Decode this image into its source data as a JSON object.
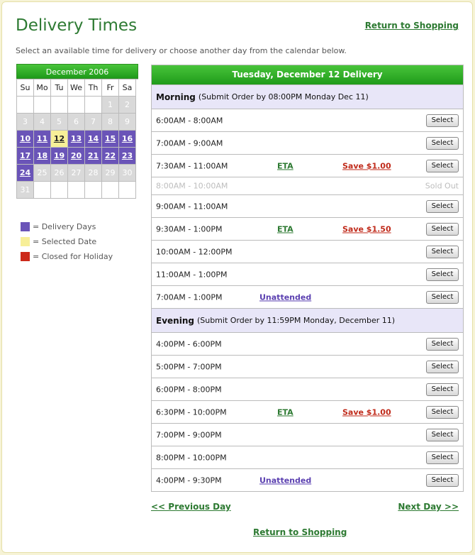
{
  "page": {
    "title": "Delivery Times",
    "return_top": "Return to Shopping",
    "instructions": "Select an available time for delivery or choose another day from the calendar below.",
    "prev_day": "<< Previous Day",
    "next_day": "Next Day >>",
    "return_bottom": "Return to Shopping"
  },
  "calendar": {
    "month": "December 2006",
    "days_of_week": [
      "Su",
      "Mo",
      "Tu",
      "We",
      "Th",
      "Fr",
      "Sa"
    ],
    "cells": [
      {
        "label": "",
        "state": "blank"
      },
      {
        "label": "",
        "state": "blank"
      },
      {
        "label": "",
        "state": "blank"
      },
      {
        "label": "",
        "state": "blank"
      },
      {
        "label": "",
        "state": "blank"
      },
      {
        "label": "1",
        "state": "past"
      },
      {
        "label": "2",
        "state": "past"
      },
      {
        "label": "3",
        "state": "past"
      },
      {
        "label": "4",
        "state": "past"
      },
      {
        "label": "5",
        "state": "past"
      },
      {
        "label": "6",
        "state": "past"
      },
      {
        "label": "7",
        "state": "past"
      },
      {
        "label": "8",
        "state": "past"
      },
      {
        "label": "9",
        "state": "past"
      },
      {
        "label": "10",
        "state": "delivery"
      },
      {
        "label": "11",
        "state": "delivery"
      },
      {
        "label": "12",
        "state": "selected"
      },
      {
        "label": "13",
        "state": "delivery"
      },
      {
        "label": "14",
        "state": "delivery"
      },
      {
        "label": "15",
        "state": "delivery"
      },
      {
        "label": "16",
        "state": "delivery"
      },
      {
        "label": "17",
        "state": "delivery"
      },
      {
        "label": "18",
        "state": "delivery"
      },
      {
        "label": "19",
        "state": "delivery"
      },
      {
        "label": "20",
        "state": "delivery"
      },
      {
        "label": "21",
        "state": "delivery"
      },
      {
        "label": "22",
        "state": "delivery"
      },
      {
        "label": "23",
        "state": "delivery"
      },
      {
        "label": "24",
        "state": "delivery"
      },
      {
        "label": "25",
        "state": "past"
      },
      {
        "label": "26",
        "state": "past"
      },
      {
        "label": "27",
        "state": "past"
      },
      {
        "label": "28",
        "state": "past"
      },
      {
        "label": "29",
        "state": "past"
      },
      {
        "label": "30",
        "state": "past"
      },
      {
        "label": "31",
        "state": "past"
      },
      {
        "label": "",
        "state": "blank"
      },
      {
        "label": "",
        "state": "blank"
      },
      {
        "label": "",
        "state": "blank"
      },
      {
        "label": "",
        "state": "blank"
      },
      {
        "label": "",
        "state": "blank"
      },
      {
        "label": "",
        "state": "blank"
      }
    ]
  },
  "legend": [
    {
      "label": "= Delivery Days",
      "color": "#6a54b8"
    },
    {
      "label": "= Selected Date",
      "color": "#f7ef98"
    },
    {
      "label": "= Closed for Holiday",
      "color": "#cc2a1a"
    }
  ],
  "schedule": {
    "header": "Tuesday, December 12 Delivery",
    "sections": [
      {
        "name": "Morning",
        "note": "(Submit Order by 08:00PM Monday Dec 11)",
        "slots": [
          {
            "time": "6:00AM - 8:00AM",
            "action": "Select"
          },
          {
            "time": "7:00AM - 9:00AM",
            "action": "Select"
          },
          {
            "time": "7:30AM - 11:00AM",
            "eta": "ETA",
            "save": "Save $1.00",
            "action": "Select"
          },
          {
            "time": "8:00AM - 10:00AM",
            "sold_out": "Sold Out"
          },
          {
            "time": "9:00AM - 11:00AM",
            "action": "Select"
          },
          {
            "time": "9:30AM - 1:00PM",
            "eta": "ETA",
            "save": "Save $1.50",
            "action": "Select"
          },
          {
            "time": "10:00AM - 12:00PM",
            "action": "Select"
          },
          {
            "time": "11:00AM - 1:00PM",
            "action": "Select"
          },
          {
            "time": "7:00AM - 1:00PM",
            "unattended": "Unattended",
            "action": "Select"
          }
        ]
      },
      {
        "name": "Evening",
        "note": "(Submit Order by 11:59PM Monday, December 11)",
        "slots": [
          {
            "time": "4:00PM - 6:00PM",
            "action": "Select"
          },
          {
            "time": "5:00PM - 7:00PM",
            "action": "Select"
          },
          {
            "time": "6:00PM - 8:00PM",
            "action": "Select"
          },
          {
            "time": "6:30PM - 10:00PM",
            "eta": "ETA",
            "save": "Save $1.00",
            "action": "Select"
          },
          {
            "time": "7:00PM - 9:00PM",
            "action": "Select"
          },
          {
            "time": "8:00PM - 10:00PM",
            "action": "Select"
          },
          {
            "time": "4:00PM - 9:30PM",
            "unattended": "Unattended",
            "action": "Select"
          }
        ]
      }
    ]
  }
}
